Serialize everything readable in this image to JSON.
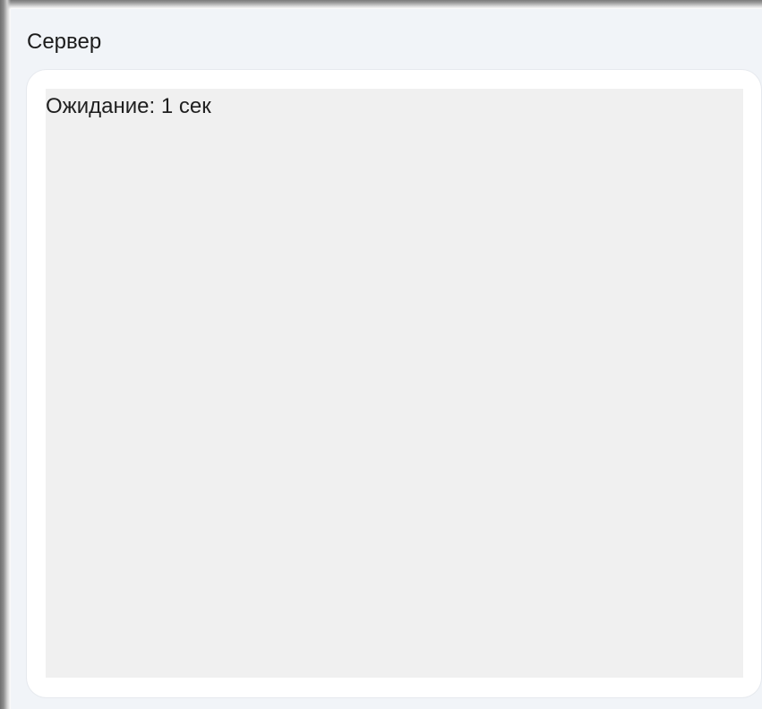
{
  "panel": {
    "title": "Сервер"
  },
  "content": {
    "status_text": "Ожидание: 1 сек"
  },
  "colors": {
    "panel_background": "#f1f4f8",
    "card_background": "#ffffff",
    "content_background": "#f0f0f0",
    "text": "#1f1f1f"
  }
}
